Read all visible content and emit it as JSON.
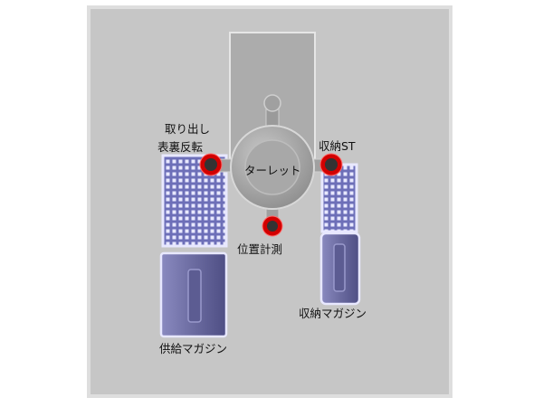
{
  "labels": {
    "takeout_line1": "取り出し",
    "takeout_line2": "表裏反転",
    "storage_st": "収納ST",
    "turret": "ターレット",
    "position_measure": "位置計測",
    "storage_magazine": "収納マガジン",
    "supply_magazine": "供給マガジン"
  },
  "colors": {
    "panel_bg": "#c6c6c6",
    "panel_border": "#dedede",
    "rail": "#acacac",
    "turret": "#a8a8a8",
    "tray_fill": "#6d6fb8",
    "tray_border": "#e8e8ff",
    "magazine_fill": "#6b6ba0",
    "station_ring": "#d20000",
    "station_core": "#333333"
  }
}
